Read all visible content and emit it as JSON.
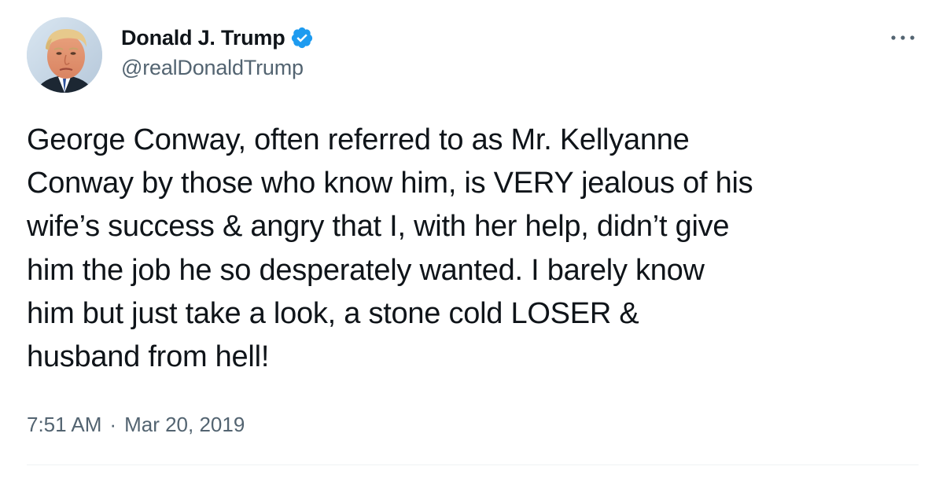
{
  "author": {
    "display_name": "Donald J. Trump",
    "handle": "@realDonaldTrump",
    "verified": true,
    "avatar_icon": "profile-photo",
    "verified_icon": "verified-badge-icon"
  },
  "menu": {
    "icon": "more-options-icon"
  },
  "tweet": {
    "text": "George Conway, often referred to as Mr. Kellyanne\nConway by those who know him, is VERY jealous of his\nwife’s success & angry that I, with her help, didn’t give\nhim the job he so desperately wanted. I barely know\nhim but just take a look, a stone cold LOSER &\nhusband from hell!",
    "time": "7:51 AM",
    "separator": "·",
    "date": "Mar 20, 2019"
  },
  "colors": {
    "text_primary": "#0f1419",
    "text_secondary": "#536471",
    "verified_blue": "#1d9bf0",
    "divider": "#eff3f4"
  }
}
